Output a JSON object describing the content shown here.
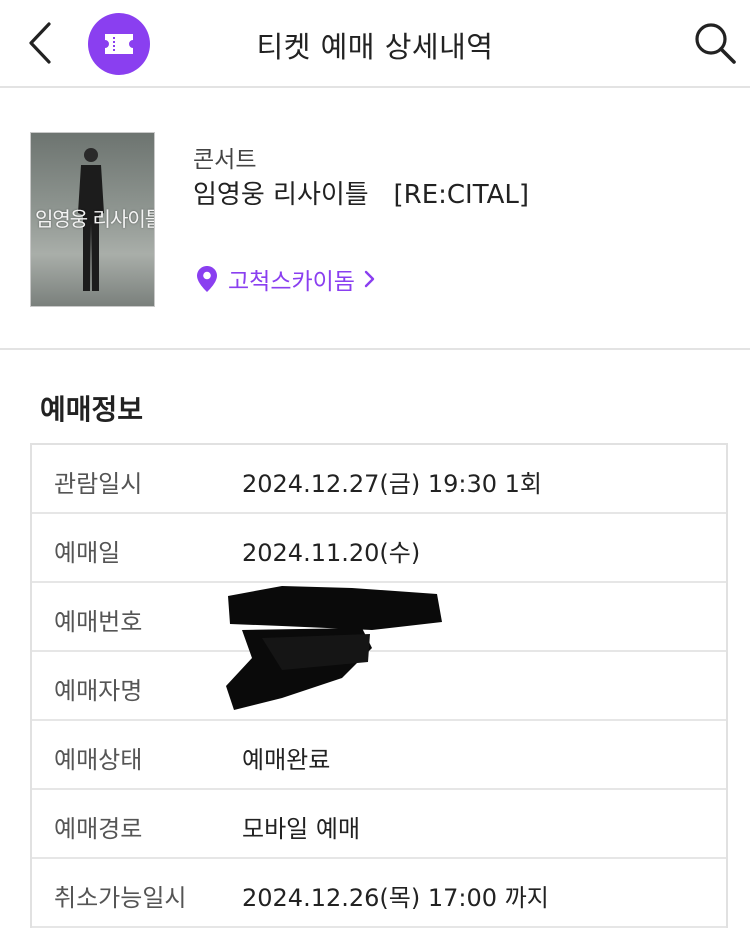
{
  "header": {
    "back_icon": "chevron-left-icon",
    "logo_icon": "ticket-icon",
    "title": "티켓 예매 상세내역",
    "search_icon": "search-icon"
  },
  "event": {
    "category": "콘서트",
    "title": "임영웅 리사이틀   [RE:CITAL]",
    "venue": "고척스카이돔",
    "venue_icon": "location-pin-icon",
    "poster_text": "임영웅 리사이틀"
  },
  "booking": {
    "heading": "예매정보",
    "rows": [
      {
        "label": "관람일시",
        "value": "2024.12.27(금) 19:30 1회"
      },
      {
        "label": "예매일",
        "value": "2024.11.20(수)"
      },
      {
        "label": "예매번호",
        "value": ""
      },
      {
        "label": "예매자명",
        "value": ""
      },
      {
        "label": "예매상태",
        "value": "예매완료"
      },
      {
        "label": "예매경로",
        "value": "모바일 예매"
      },
      {
        "label": "취소가능일시",
        "value": "2024.12.26(목) 17:00 까지"
      }
    ]
  },
  "colors": {
    "accent": "#8a3ff0",
    "divider": "#e3e3e3"
  }
}
